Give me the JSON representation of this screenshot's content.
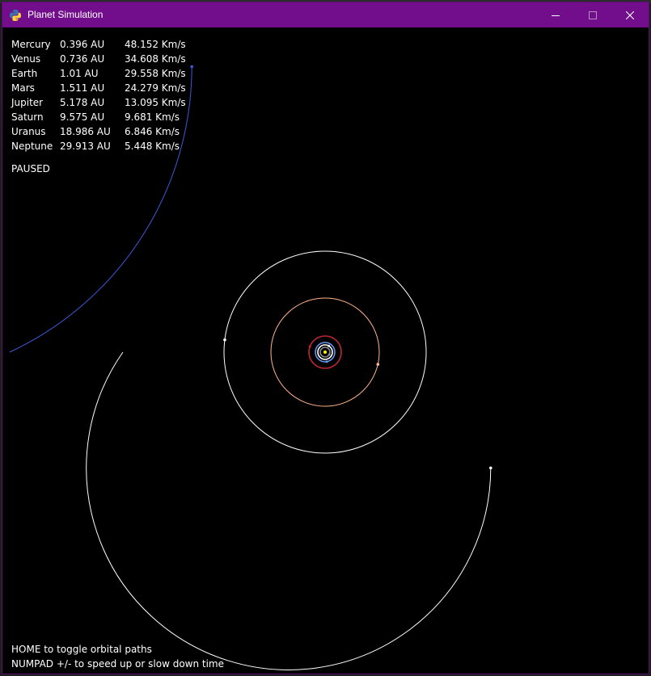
{
  "window": {
    "title": "Planet Simulation",
    "titlebar_color": "#720e8c",
    "icon": "python-icon"
  },
  "planets": [
    {
      "name": "Mercury",
      "distance": "0.396 AU",
      "speed": "48.152 Km/s",
      "color": "#8c8c8c",
      "orbit_au": 0.396
    },
    {
      "name": "Venus",
      "distance": "0.736 AU",
      "speed": "34.608 Km/s",
      "color": "#ffffff",
      "orbit_au": 0.736
    },
    {
      "name": "Earth",
      "distance": "1.01 AU",
      "speed": "29.558 Km/s",
      "color": "#6495ed",
      "orbit_au": 1.01
    },
    {
      "name": "Mars",
      "distance": "1.511 AU",
      "speed": "24.279 Km/s",
      "color": "#bc2732",
      "orbit_au": 1.511
    },
    {
      "name": "Jupiter",
      "distance": "5.178 AU",
      "speed": "13.095 Km/s",
      "color": "#ffb48c",
      "orbit_au": 5.178
    },
    {
      "name": "Saturn",
      "distance": "9.575 AU",
      "speed": "9.681 Km/s",
      "color": "#ffffff",
      "orbit_au": 9.575
    },
    {
      "name": "Uranus",
      "distance": "18.986 AU",
      "speed": "6.846 Km/s",
      "color": "#ffffff",
      "orbit_au": 18.986
    },
    {
      "name": "Neptune",
      "distance": "29.913 AU",
      "speed": "5.448 Km/s",
      "color": "#3c5adc",
      "orbit_au": 29.913
    }
  ],
  "sun_color": "#ffff00",
  "status": "PAUSED",
  "help": {
    "line1": "HOME to toggle orbital paths",
    "line2": "NUMPAD +/- to speed up or slow down time"
  }
}
